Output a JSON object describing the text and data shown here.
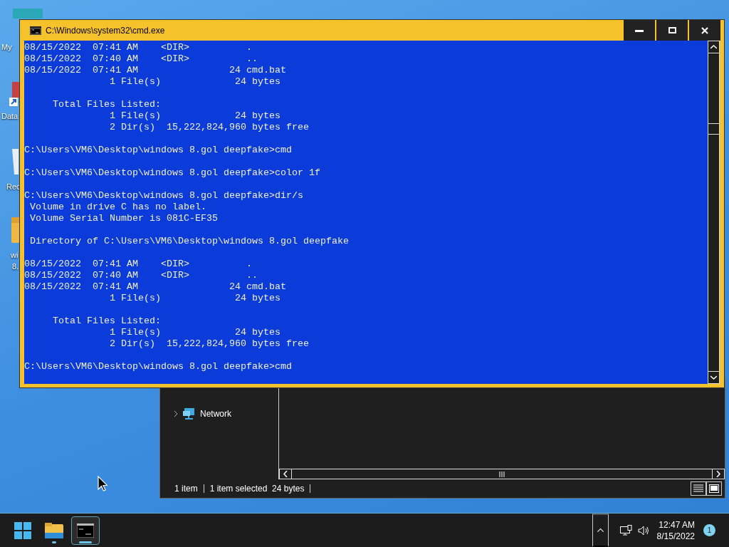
{
  "desktop_icons": [
    {
      "kind": "monitor",
      "label_lines": [
        "My"
      ]
    },
    {
      "kind": "shortcut",
      "label_lines": [
        "Data"
      ]
    },
    {
      "kind": "bin",
      "label_lines": [
        "Rec"
      ]
    },
    {
      "kind": "folder",
      "label_lines": [
        "wi",
        "8."
      ]
    }
  ],
  "explorer": {
    "nav_items": [
      {
        "label": "Network",
        "expanded": false
      }
    ],
    "status_bar": [
      "1 item",
      "1 item selected  24 bytes"
    ]
  },
  "cmd": {
    "title": "C:\\Windows\\system32\\cmd.exe",
    "blocks": [
      [
        "08/15/2022  07:41 AM    <DIR>          .",
        "08/15/2022  07:40 AM    <DIR>          ..",
        "08/15/2022  07:41 AM                24 cmd.bat",
        "               1 File(s)             24 bytes"
      ],
      [
        "     Total Files Listed:",
        "               1 File(s)             24 bytes",
        "               2 Dir(s)  15,222,824,960 bytes free"
      ],
      [
        "C:\\Users\\VM6\\Desktop\\windows 8.gol deepfake>cmd"
      ],
      [
        "C:\\Users\\VM6\\Desktop\\windows 8.gol deepfake>color 1f"
      ],
      [
        "C:\\Users\\VM6\\Desktop\\windows 8.gol deepfake>dir/s",
        " Volume in drive C has no label.",
        " Volume Serial Number is 081C-EF35"
      ],
      [
        " Directory of C:\\Users\\VM6\\Desktop\\windows 8.gol deepfake"
      ],
      [
        "08/15/2022  07:41 AM    <DIR>          .",
        "08/15/2022  07:40 AM    <DIR>          ..",
        "08/15/2022  07:41 AM                24 cmd.bat",
        "               1 File(s)             24 bytes"
      ],
      [
        "     Total Files Listed:",
        "               1 File(s)             24 bytes",
        "               2 Dir(s)  15,222,824,960 bytes free"
      ],
      [
        "C:\\Users\\VM6\\Desktop\\windows 8.gol deepfake>cmd"
      ]
    ]
  },
  "taskbar": {
    "apps": [
      {
        "kind": "start",
        "open": false,
        "active": false
      },
      {
        "kind": "explorer",
        "open": true,
        "active": false
      },
      {
        "kind": "terminal",
        "open": true,
        "active": true
      }
    ],
    "time": "12:47 AM",
    "date": "8/15/2022",
    "notification_count": "1"
  }
}
